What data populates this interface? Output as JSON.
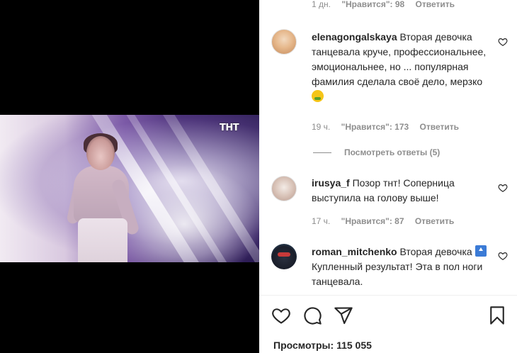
{
  "video": {
    "channel_logo": "ТНТ"
  },
  "comments_top": {
    "meta_time": "1 дн.",
    "meta_likes": "\"Нравится\": 98",
    "meta_reply": "Ответить"
  },
  "comments": [
    {
      "username": "elenagongalskaya",
      "text": "Вторая девочка танцевала круче, профессиональнее, эмоциональнее, но ... популярная фамилия сделала своё дело, мерзко",
      "emoji": "nauseated-face-emoji",
      "time": "19 ч.",
      "likes": "\"Нравится\": 173",
      "reply": "Ответить"
    },
    {
      "username": "irusya_f",
      "text": "Позор тнт! Соперница выступила на голову выше!",
      "time": "17 ч.",
      "likes": "\"Нравится\": 87",
      "reply": "Ответить"
    },
    {
      "username": "roman_mitchenko",
      "text_before": "Вторая девочка",
      "badge": "top-emoji",
      "text_after": "Купленный результат! Эта в пол ноги танцевала."
    }
  ],
  "view_replies": "Посмотреть ответы (5)",
  "actions": {
    "icons": [
      "heart-icon",
      "comment-icon",
      "share-icon",
      "bookmark-icon"
    ]
  },
  "views": {
    "label": "Просмотры:",
    "count": "115 055"
  },
  "colors": {
    "text": "#262626",
    "muted": "#8e8e8e",
    "media_bg": "#000000"
  }
}
